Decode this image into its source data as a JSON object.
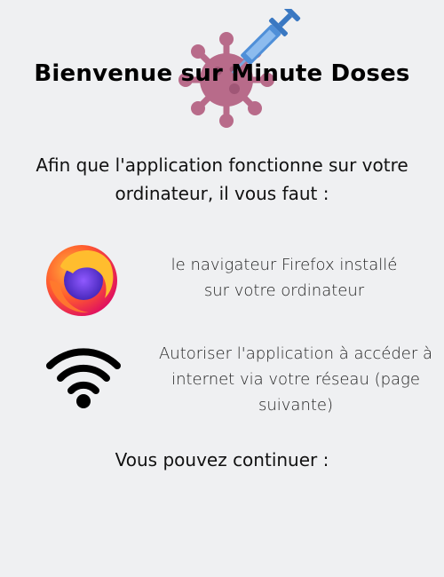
{
  "title": "Bienvenue sur Minute Doses",
  "intro": "Afin que l'application fonctionne sur votre ordinateur, il vous faut :",
  "requirements": [
    {
      "icon": "firefox-icon",
      "text": "le navigateur Firefox installé sur votre ordinateur"
    },
    {
      "icon": "wifi-icon",
      "text": "Autoriser l'application à accéder à internet via votre réseau (page suivante)"
    }
  ],
  "footer": "Vous pouvez continuer :",
  "colors": {
    "background": "#eff0f2",
    "virus": "#b86b8a",
    "syringe": "#4f8fd8"
  }
}
